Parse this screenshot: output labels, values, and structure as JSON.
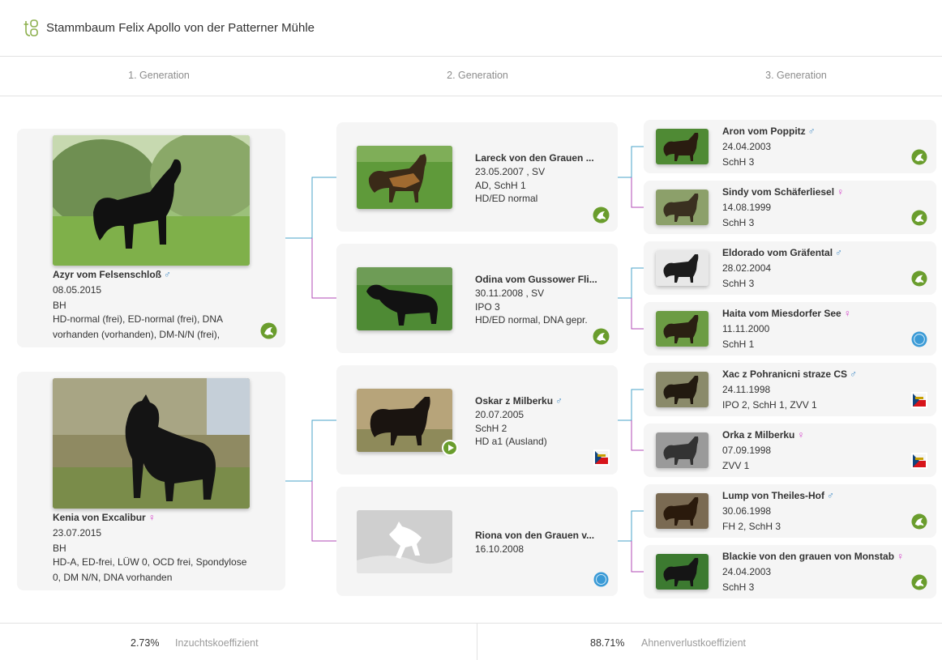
{
  "page": {
    "title": "Stammbaum Felix Apollo von der Patterner Mühle"
  },
  "generations": [
    "1. Generation",
    "2. Generation",
    "3. Generation"
  ],
  "symbols": {
    "male": "♂",
    "female": "♀"
  },
  "gen1": [
    {
      "name": "Azyr vom Felsenschloß",
      "sex": "male",
      "date": "08.05.2015",
      "title": "BH",
      "health": "HD-normal (frei), ED-normal (frei), DNA vorhanden (vorhanden), DM-N/N (frei),",
      "badge": "sv-green-icon"
    },
    {
      "name": "Kenia von Excalibur",
      "sex": "female",
      "date": "23.07.2015",
      "title": "BH",
      "health": "HD-A, ED-frei, LÜW 0, OCD frei, Spondylose 0, DM N/N, DNA vorhanden",
      "badge": ""
    }
  ],
  "gen2": [
    {
      "name": "Lareck von den Grauen ...",
      "sex": "",
      "line1": "23.05.2007 , SV",
      "line2": "AD, SchH 1",
      "line3": "HD/ED normal",
      "badge": "sv-green-icon"
    },
    {
      "name": "Odina vom Gussower Fli...",
      "sex": "",
      "line1": "30.11.2008 , SV",
      "line2": "IPO 3",
      "line3": "HD/ED normal, DNA gepr.",
      "badge": "sv-green-icon"
    },
    {
      "name": "Oskar z Milberku",
      "sex": "male",
      "line1": "20.07.2005",
      "line2": "SchH 2",
      "line3": "HD a1 (Ausland)",
      "badge": "czech-flag-icon",
      "video": true
    },
    {
      "name": "Riona von den Grauen v...",
      "sex": "",
      "line1": "16.10.2008",
      "line2": "",
      "line3": "",
      "badge": "vdh-blue-icon",
      "placeholder": true
    }
  ],
  "gen3": [
    {
      "name": "Aron vom Poppitz",
      "sex": "male",
      "date": "24.04.2003",
      "title": "SchH 3",
      "badge": "sv-green-icon"
    },
    {
      "name": "Sindy vom Schäferliesel",
      "sex": "female",
      "date": "14.08.1999",
      "title": "SchH 3",
      "badge": "sv-green-icon"
    },
    {
      "name": "Eldorado vom Gräfental",
      "sex": "male",
      "date": "28.02.2004",
      "title": "SchH 3",
      "badge": "sv-green-icon"
    },
    {
      "name": "Haita vom Miesdorfer See",
      "sex": "female",
      "date": "11.11.2000",
      "title": "SchH 1",
      "badge": "vdh-blue-icon"
    },
    {
      "name": "Xac z Pohranicni straze CS",
      "sex": "male",
      "date": "24.11.1998",
      "title": "IPO 2, SchH 1, ZVV 1",
      "badge": "czech-flag-icon"
    },
    {
      "name": "Orka z Milberku",
      "sex": "female",
      "date": "07.09.1998",
      "title": "ZVV 1",
      "badge": "czech-flag-icon"
    },
    {
      "name": "Lump von Theiles-Hof",
      "sex": "male",
      "date": "30.06.1998",
      "title": "FH 2, SchH 3",
      "badge": "sv-green-icon"
    },
    {
      "name": "Blackie von den grauen von Monstab",
      "sex": "female",
      "date": "24.04.2003",
      "title": "SchH 3",
      "badge": "sv-green-icon"
    }
  ],
  "footer": {
    "inbreeding_value": "2.73%",
    "inbreeding_label": "Inzuchtskoeffizient",
    "ancestor_loss_value": "88.71%",
    "ancestor_loss_label": "Ahnenverlustkoeffizient"
  },
  "colors": {
    "male_line": "#4aa3c8",
    "female_line": "#b24ab5",
    "brand_green": "#6a9d2d",
    "card_bg": "#f5f5f5"
  }
}
